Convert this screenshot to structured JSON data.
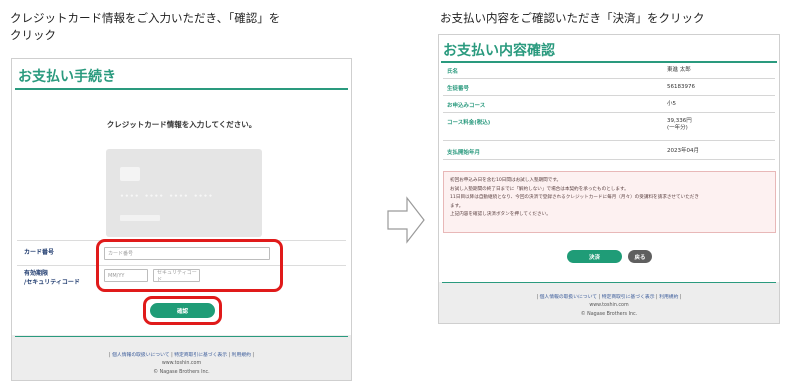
{
  "captions": {
    "left_line1": "クレジットカード情報をご入力いただき､「確認」を",
    "left_line2": "クリック",
    "right": "お支払い内容をご確認いただき「決済」をクリック"
  },
  "colors": {
    "brand_green": "#2a9a7e",
    "button_green": "#1f9c77",
    "highlight_red": "#e01a1a",
    "back_button_gray": "#5f5f5f"
  },
  "left_panel": {
    "title": "お支払い手続き",
    "instruction": "クレジットカード情報を入力してください。",
    "card_image": {
      "icon": "credit-card-icon",
      "digits": "•••• •••• •••• ••••"
    },
    "card_number": {
      "label": "カード番号",
      "placeholder": "カード番号"
    },
    "expiry": {
      "label_line1": "有効期限",
      "label_line2": "/セキュリティコード",
      "exp_placeholder": "MM/YY",
      "cvc_placeholder": "セキュリティコード"
    },
    "confirm_button": "確認",
    "footer": {
      "link1": "個人情報の取扱いについて",
      "link2": "特定商取引に基づく表示",
      "link3": "利用規約",
      "url": "www.toshin.com",
      "copyright": "© Nagase Brothers Inc."
    }
  },
  "arrow": {
    "icon": "right-arrow-icon"
  },
  "right_panel": {
    "title": "お支払い内容確認",
    "rows": [
      {
        "label": "氏名",
        "value": "東進 太郎"
      },
      {
        "label": "生徒番号",
        "value": "56183976"
      },
      {
        "label": "お申込みコース",
        "value": "小5"
      },
      {
        "label": "コース料金(税込)",
        "value": "39,336円",
        "value2": "(一年分)"
      },
      {
        "label": "支払開始年月",
        "value": "2023年04月"
      }
    ],
    "notice": [
      "初回お申込み日を含む10日間はお試し入塾期間です。",
      "お試し入塾期間の終了日までに「解約しない」で場合は本契約を承ったものとします。",
      "11日目以降は自動継続となり、今回の決済で登録されるクレジットカードに毎月（月々）の受講料を請求させていただき",
      "ます。",
      "上記内容を確認し決済ボタンを押してください。"
    ],
    "settle_button": "決済",
    "back_button": "戻る",
    "footer": {
      "link1": "個人情報の取扱いについて",
      "link2": "特定商取引に基づく表示",
      "link3": "利用規約",
      "url": "www.toshin.com",
      "copyright": "© Nagase Brothers Inc."
    }
  }
}
